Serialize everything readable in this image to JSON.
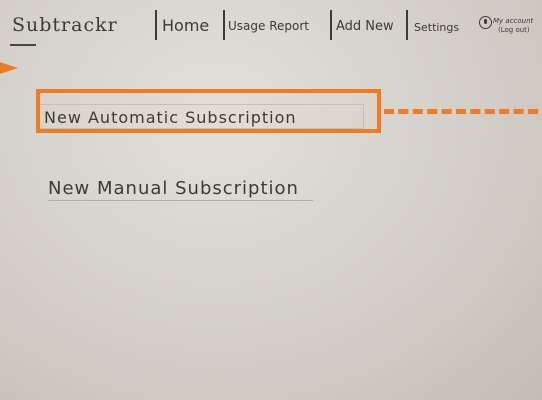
{
  "app": {
    "name": "Subtrackr"
  },
  "nav": {
    "home": "Home",
    "usage_report": "Usage Report",
    "add_new": "Add New",
    "settings": "Settings",
    "account": "My account",
    "logout": "(Log out)"
  },
  "main": {
    "automatic": "New Automatic Subscription",
    "manual": "New Manual Subscription"
  },
  "annotation": {
    "color": "#ee7b26"
  },
  "icons": {
    "account": "info-icon"
  }
}
